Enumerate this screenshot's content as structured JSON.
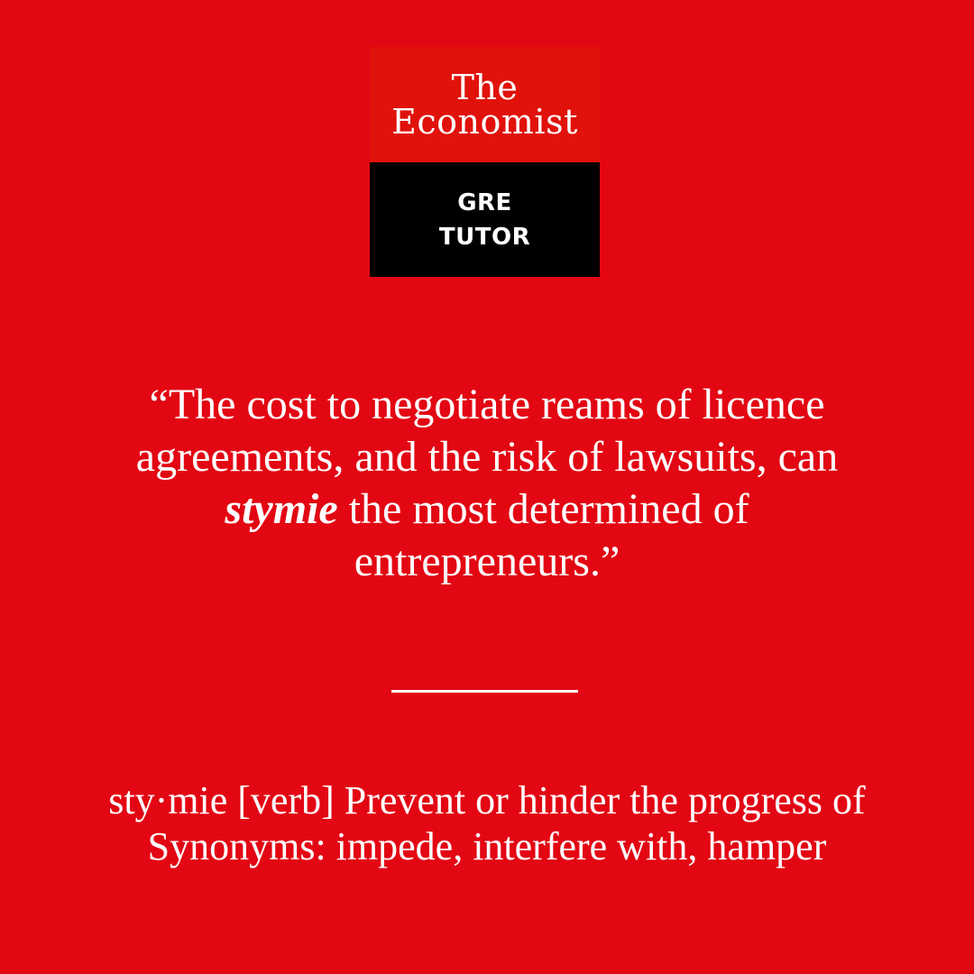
{
  "colors": {
    "background": "#e30613",
    "logo_top": "#e0120b",
    "logo_bottom": "#000000",
    "text": "#ffffff"
  },
  "logo": {
    "line1": "The",
    "line2": "Economist",
    "sub1": "GRE",
    "sub2": "TUTOR"
  },
  "quote": {
    "open_mark": "“",
    "before": "The cost to negotiate reams of licence agreements, and the risk of lawsuits, can ",
    "emphasis": "stymie",
    "after": " the most determined of entrepreneurs.",
    "close_mark": "”"
  },
  "definition": {
    "line1": "sty·mie [verb] Prevent or hinder the progress of",
    "line2": "Synonyms: impede, interfere with, hamper"
  }
}
